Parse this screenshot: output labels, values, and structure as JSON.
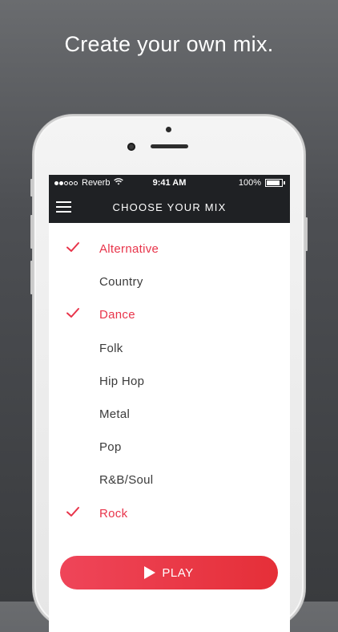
{
  "headline": "Create your own mix.",
  "status_bar": {
    "signal_bars_full": 2,
    "signal_bars_total": 5,
    "carrier": "Reverb",
    "wifi_icon": "wifi-icon",
    "time": "9:41 AM",
    "battery_text": "100%",
    "battery_level": 1.0
  },
  "nav": {
    "title": "CHOOSE YOUR MIX",
    "menu_icon": "hamburger-menu-icon"
  },
  "genres": [
    {
      "label": "Alternative",
      "selected": true
    },
    {
      "label": "Country",
      "selected": false
    },
    {
      "label": "Dance",
      "selected": true
    },
    {
      "label": "Folk",
      "selected": false
    },
    {
      "label": "Hip Hop",
      "selected": false
    },
    {
      "label": "Metal",
      "selected": false
    },
    {
      "label": "Pop",
      "selected": false
    },
    {
      "label": "R&B/Soul",
      "selected": false
    },
    {
      "label": "Rock",
      "selected": true
    }
  ],
  "play_button": {
    "label": "PLAY",
    "icon": "play-icon"
  },
  "colors": {
    "accent": "#e8344a",
    "bar_background": "#1f2124",
    "text": "#3b3b3b"
  }
}
